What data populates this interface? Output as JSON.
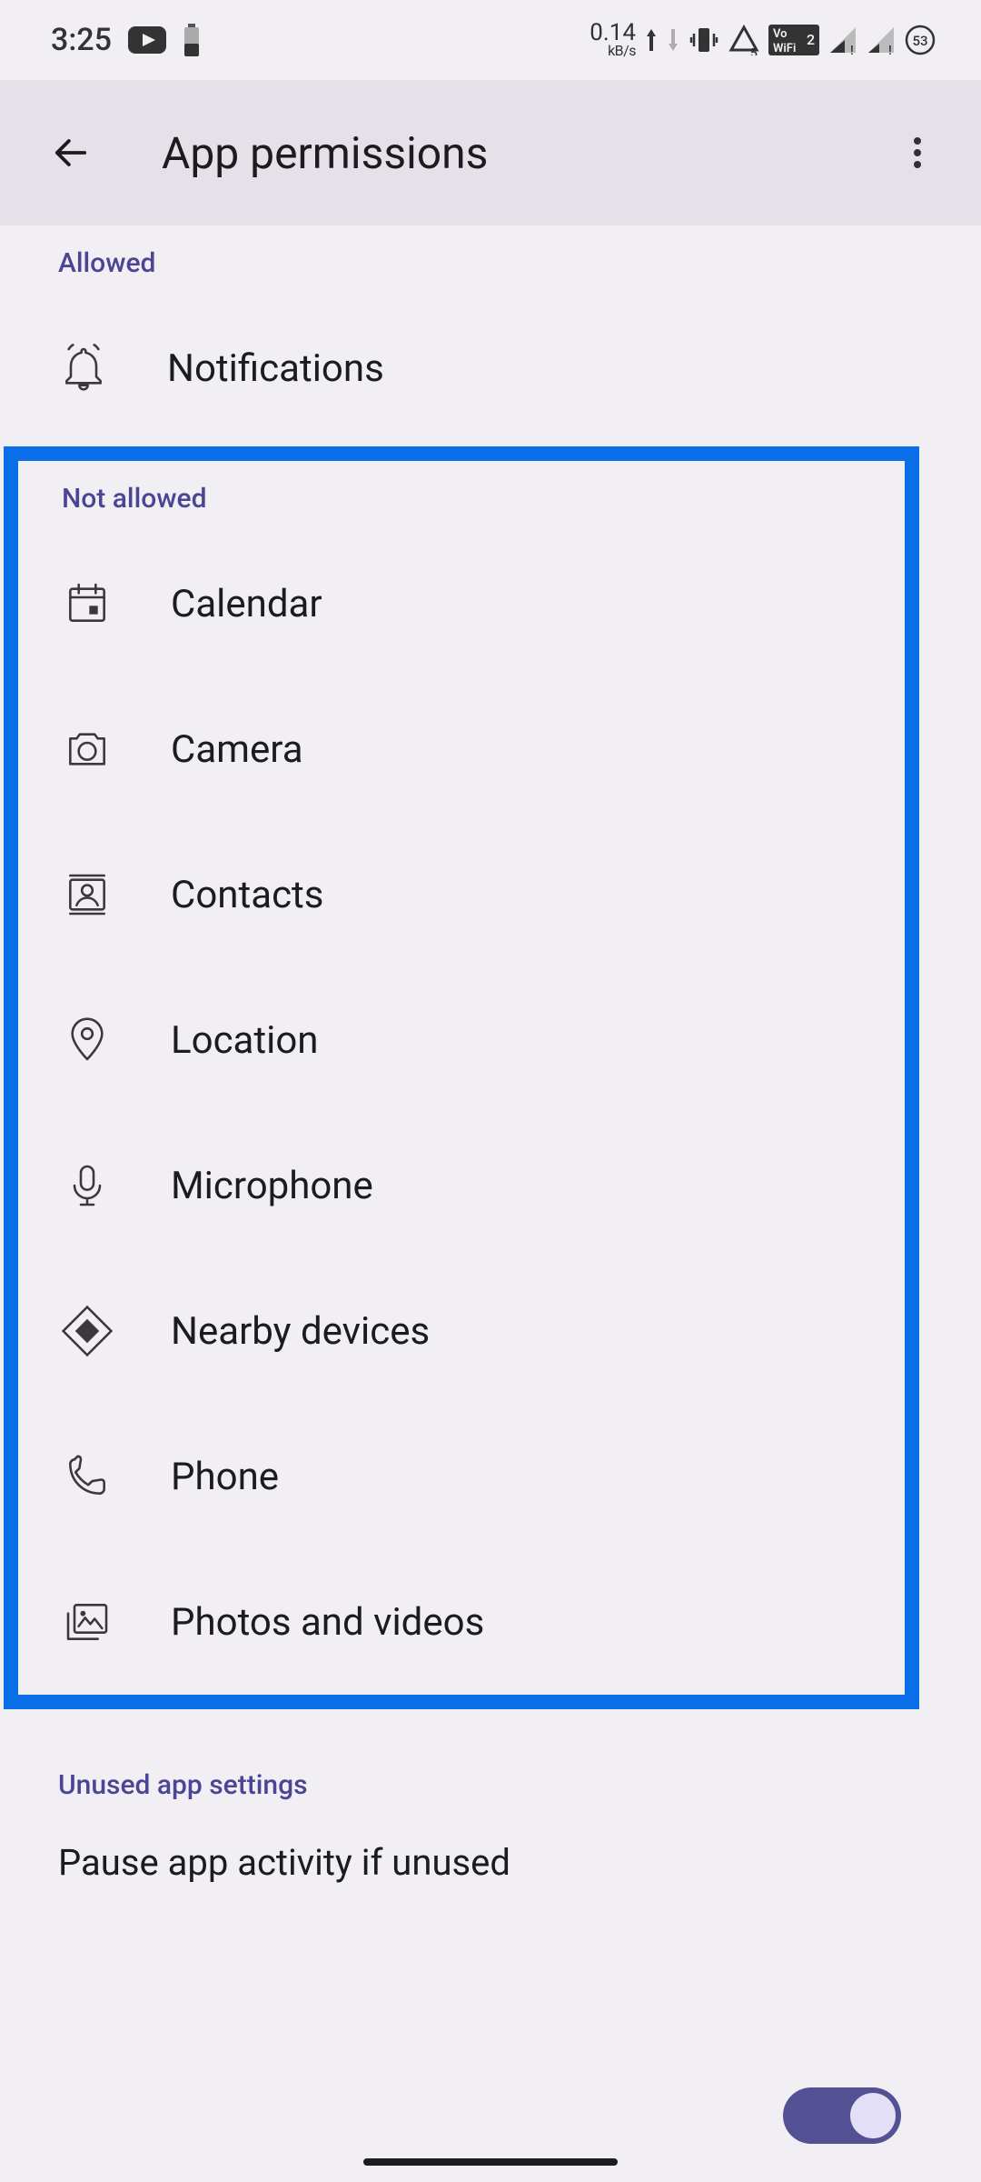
{
  "status": {
    "time": "3:25",
    "data_rate": "0.14",
    "data_unit": "kB/s",
    "battery_pct": "53"
  },
  "header": {
    "title": "App permissions"
  },
  "sections": {
    "allowed_label": "Allowed",
    "not_allowed_label": "Not allowed",
    "unused_label": "Unused app settings"
  },
  "permissions": {
    "allowed": [
      {
        "icon": "notifications-icon",
        "label": "Notifications"
      }
    ],
    "not_allowed": [
      {
        "icon": "calendar-icon",
        "label": "Calendar"
      },
      {
        "icon": "camera-icon",
        "label": "Camera"
      },
      {
        "icon": "contacts-icon",
        "label": "Contacts"
      },
      {
        "icon": "location-icon",
        "label": "Location"
      },
      {
        "icon": "microphone-icon",
        "label": "Microphone"
      },
      {
        "icon": "nearby-devices-icon",
        "label": "Nearby devices"
      },
      {
        "icon": "phone-icon",
        "label": "Phone"
      },
      {
        "icon": "photos-videos-icon",
        "label": "Photos and videos"
      }
    ]
  },
  "unused": {
    "pause_label": "Pause app activity if unused",
    "pause_enabled": true
  }
}
